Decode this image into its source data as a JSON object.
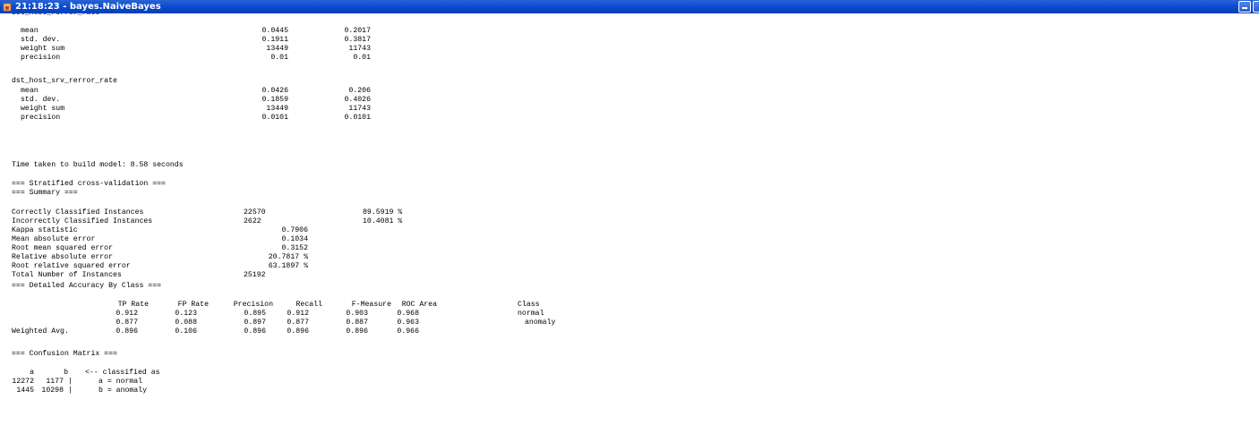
{
  "window": {
    "title": "21:18:23 - bayes.NaiveBayes",
    "icon": "java-cup-icon"
  },
  "attr_top": {
    "name": "dst_host_rerror_rate",
    "rows": [
      {
        "label": "mean",
        "a": "0.0445",
        "b": "0.2017"
      },
      {
        "label": "std. dev.",
        "a": "0.1911",
        "b": "0.3817"
      },
      {
        "label": "weight sum",
        "a": "13449",
        "b": "11743"
      },
      {
        "label": "precision",
        "a": "0.01",
        "b": "0.01"
      }
    ]
  },
  "attr_bottom": {
    "name": "dst_host_srv_rerror_rate",
    "rows": [
      {
        "label": "mean",
        "a": "0.0426",
        "b": "0.206"
      },
      {
        "label": "std. dev.",
        "a": "0.1859",
        "b": "0.4026"
      },
      {
        "label": "weight sum",
        "a": "13449",
        "b": "11743"
      },
      {
        "label": "precision",
        "a": "0.0101",
        "b": "0.0101"
      }
    ]
  },
  "time_taken": "Time taken to build model: 8.58 seconds",
  "cv_header": "=== Stratified cross-validation ===",
  "summary_header": "=== Summary ===",
  "summary": [
    {
      "label": "Correctly Classified Instances",
      "value": "22570",
      "extra": "89.5919 %"
    },
    {
      "label": "Incorrectly Classified Instances",
      "value": "2622",
      "extra": "10.4081 %"
    },
    {
      "label": "Kappa statistic",
      "value": "0.7906",
      "extra": ""
    },
    {
      "label": "Mean absolute error",
      "value": "0.1034",
      "extra": ""
    },
    {
      "label": "Root mean squared error",
      "value": "0.3152",
      "extra": ""
    },
    {
      "label": "Relative absolute error",
      "value": "20.7817 %",
      "extra": ""
    },
    {
      "label": "Root relative squared error",
      "value": "63.1897 %",
      "extra": ""
    },
    {
      "label": "Total Number of Instances",
      "value": "25192",
      "extra": ""
    }
  ],
  "accuracy_header": "=== Detailed Accuracy By Class ===",
  "accuracy": {
    "columns": [
      "TP Rate",
      "FP Rate",
      "Precision",
      "Recall",
      "F-Measure",
      "ROC Area",
      "Class"
    ],
    "rows": [
      {
        "label": "",
        "cells": [
          "0.912",
          "0.123",
          "0.895",
          "0.912",
          "0.903",
          "0.968",
          "normal"
        ]
      },
      {
        "label": "",
        "cells": [
          "0.877",
          "0.088",
          "0.897",
          "0.877",
          "0.887",
          "0.963",
          "anomaly"
        ]
      },
      {
        "label": "Weighted Avg.",
        "cells": [
          "0.896",
          "0.106",
          "0.896",
          "0.896",
          "0.896",
          "0.966",
          ""
        ]
      }
    ]
  },
  "confusion_header": "=== Confusion Matrix ===",
  "confusion": {
    "header_a": "a",
    "header_b": "b",
    "header_note": "<-- classified as",
    "rows": [
      {
        "a": "12272",
        "b": "1177",
        "sep": "|",
        "label": "a = normal"
      },
      {
        "a": "1445",
        "b": "10298",
        "sep": "|",
        "label": "b = anomaly"
      }
    ]
  }
}
